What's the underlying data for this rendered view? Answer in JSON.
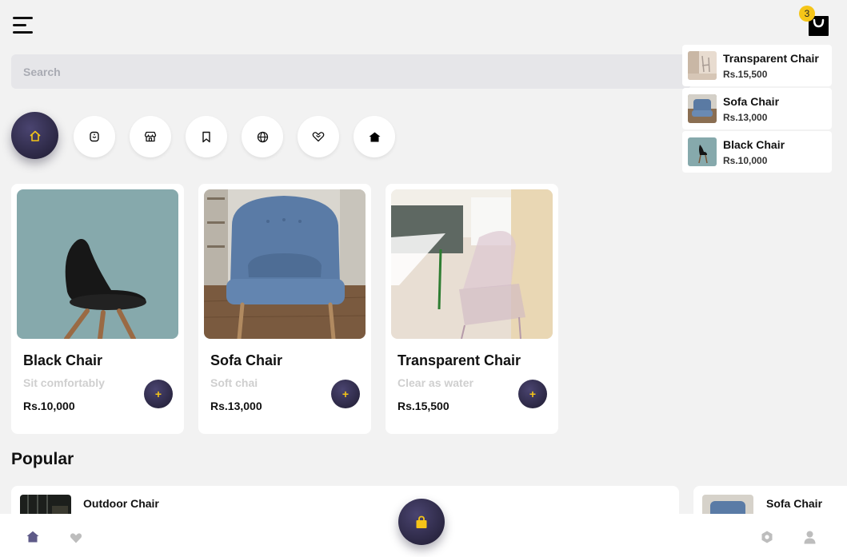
{
  "header": {
    "menu_icon": "hamburger-menu-icon",
    "cart_icon": "shopping-bag-icon",
    "cart_count": "3"
  },
  "search": {
    "placeholder": "Search",
    "value": ""
  },
  "cart_dropdown": {
    "items": [
      {
        "name": "Transparent Chair",
        "price": "Rs.15,500"
      },
      {
        "name": "Sofa Chair",
        "price": "Rs.13,000"
      },
      {
        "name": "Black Chair",
        "price": "Rs.10,000"
      }
    ]
  },
  "categories": [
    {
      "icon": "home-icon",
      "active": true
    },
    {
      "icon": "smart-tag-icon",
      "active": false
    },
    {
      "icon": "store-icon",
      "active": false
    },
    {
      "icon": "bookmark-icon",
      "active": false
    },
    {
      "icon": "globe-icon",
      "active": false
    },
    {
      "icon": "heart-handshake-icon",
      "active": false
    },
    {
      "icon": "house-filled-icon",
      "active": false
    }
  ],
  "products": [
    {
      "title": "Black Chair",
      "subtitle": "Sit comfortably",
      "price": "Rs.10,000",
      "add_label": "+"
    },
    {
      "title": "Sofa Chair",
      "subtitle": "Soft chai",
      "price": "Rs.13,000",
      "add_label": "+"
    },
    {
      "title": "Transparent Chair",
      "subtitle": "Clear as water",
      "price": "Rs.15,500",
      "add_label": "+"
    }
  ],
  "popular": {
    "title": "Popular",
    "items": [
      {
        "name": "Outdoor Chair"
      },
      {
        "name": "Sofa Chair"
      }
    ]
  },
  "bottom_nav": {
    "items": [
      "home-icon",
      "heart-icon",
      "settings-icon",
      "user-icon"
    ],
    "fab_icon": "shopping-bag-icon"
  },
  "colors": {
    "accent": "#f5c518",
    "dark": "#2b2740",
    "background": "#f2f2f2"
  }
}
